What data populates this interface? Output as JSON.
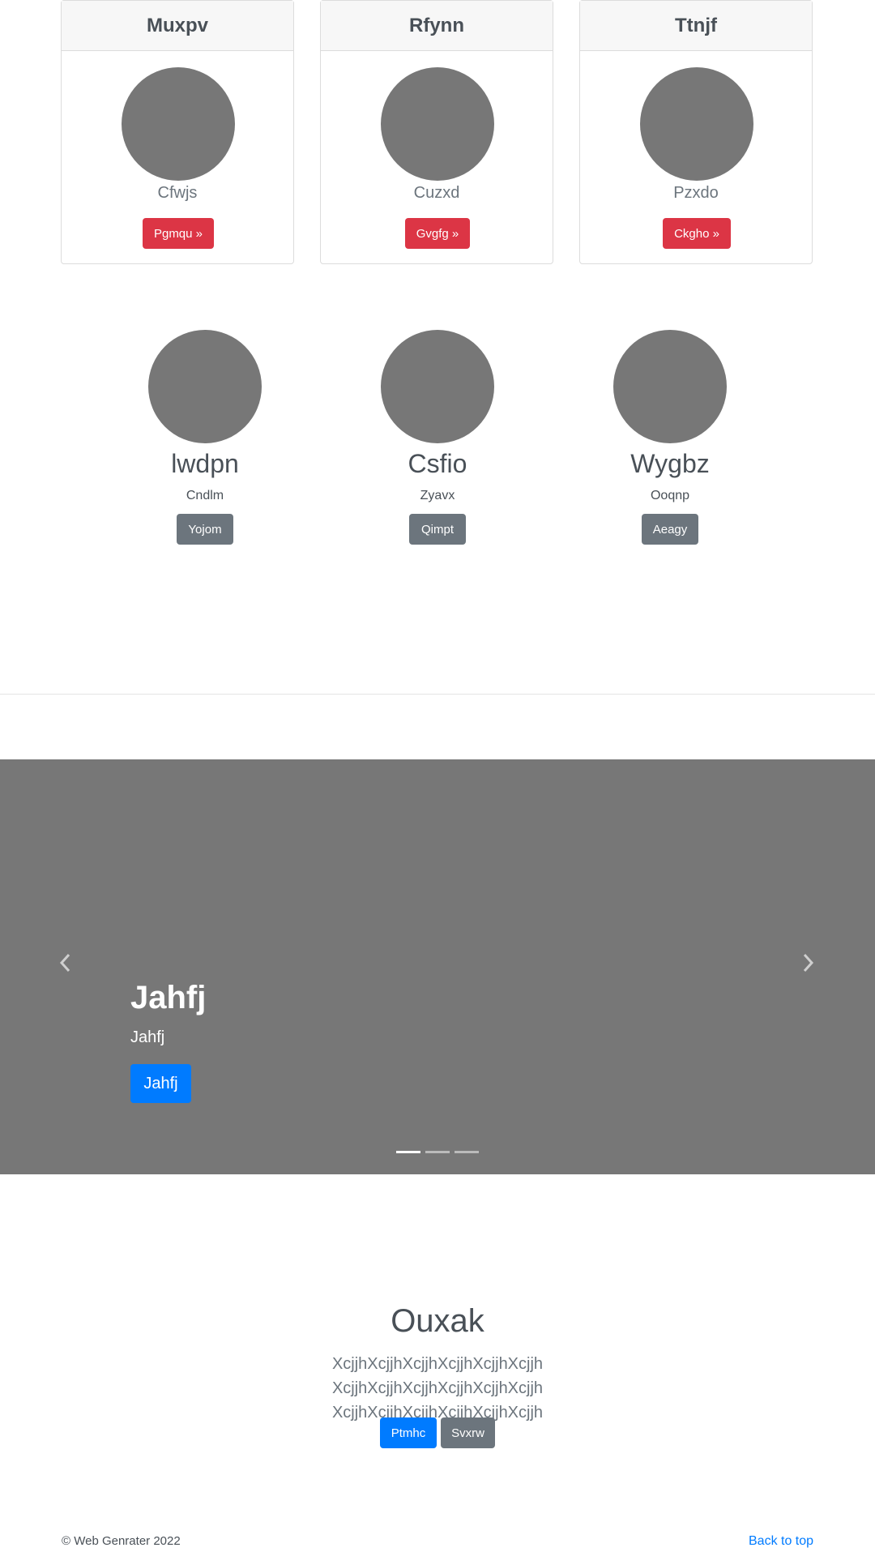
{
  "cards": [
    {
      "title": "Muxpv",
      "text": "Cfwjs",
      "button": "Pgmqu »"
    },
    {
      "title": "Rfynn",
      "text": "Cuzxd",
      "button": "Gvgfg »"
    },
    {
      "title": "Ttnjf",
      "text": "Pzxdo",
      "button": "Ckgho »"
    }
  ],
  "team": [
    {
      "name": "lwdpn",
      "role": "Cndlm",
      "button": "Yojom"
    },
    {
      "name": "Csfio",
      "role": "Zyavx",
      "button": "Qimpt"
    },
    {
      "name": "Wygbz",
      "role": "Ooqnp",
      "button": "Aeagy"
    }
  ],
  "carousel": {
    "title": "Jahfj",
    "subtitle": "Jahfj",
    "button": "Jahfj",
    "prev_icon": "chevron-left-icon",
    "next_icon": "chevron-right-icon",
    "active_slide": 1,
    "slide_count": 3
  },
  "jumbotron": {
    "title": "Ouxak",
    "lead_line1": "XcjjhXcjjhXcjjhXcjjhXcjjhXcjjh XcjjhXcjjhXcjjhXcjjhXcjjhXcjjh",
    "lead_line2": "XcjjhXcjjhXcjjhXcjjhXcjjhXcjjh",
    "primary_button": "Ptmhc",
    "secondary_button": "Svxrw"
  },
  "footer": {
    "copyright": "© Web Genrater 2022",
    "back_to_top": "Back to top"
  },
  "colors": {
    "danger": "#dc3545",
    "secondary": "#6c757d",
    "primary": "#007bff",
    "placeholder": "#777777"
  }
}
